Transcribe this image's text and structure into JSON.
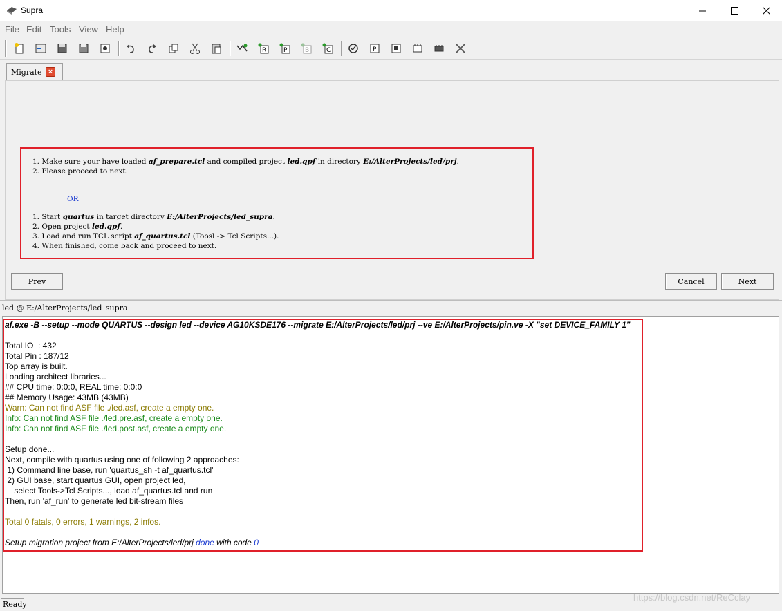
{
  "window": {
    "title": "Supra",
    "minimize_icon": "minimize-icon",
    "maximize_icon": "maximize-icon",
    "close_icon": "close-icon"
  },
  "menu": [
    "File",
    "Edit",
    "Tools",
    "View",
    "Help"
  ],
  "toolbar": {
    "icons": [
      "new-file-icon",
      "open-project-icon",
      "save-icon",
      "save-as-icon",
      "settings-icon",
      "undo-icon",
      "redo-icon",
      "copy-icon",
      "cut-icon",
      "paste-icon",
      "run-all-icon",
      "run-r-icon",
      "run-p-icon",
      "run-b-icon",
      "run-c-icon",
      "check-icon",
      "report-p-icon",
      "chip-icon",
      "program-icon",
      "device-icon",
      "stop-icon"
    ]
  },
  "tab": {
    "label": "Migrate",
    "close": "×"
  },
  "instructions": {
    "line1_num": "1.",
    "line1_a": "Make sure your have loaded ",
    "line1_b": "af_prepare.tcl",
    "line1_c": " and compiled project ",
    "line1_d": "led.qpf",
    "line1_e": " in directory ",
    "line1_f": "E:/AlterProjects/led/prj",
    "line1_g": ".",
    "line2": "2. Please proceed to next.",
    "or": "OR",
    "s1_a": "1. Start ",
    "s1_b": "quartus",
    "s1_c": " in target directory ",
    "s1_d": "E:/AlterProjects/led_supra",
    "s1_e": ".",
    "s2_a": "2. Open project ",
    "s2_b": "led.qpf",
    "s2_c": ".",
    "s3_a": "3. Load and run TCL script ",
    "s3_b": "af_quartus.tcl",
    "s3_c": " (Toosl -> Tcl Scripts...).",
    "s4": "4. When finished, come back and proceed to next."
  },
  "buttons": {
    "prev": "Prev",
    "cancel": "Cancel",
    "next": "Next"
  },
  "path_label": "led @ E:/AlterProjects/led_supra",
  "log": {
    "command": "af.exe -B --setup --mode QUARTUS --design led --device AG10KSDE176 --migrate E:/AlterProjects/led/prj --ve E:/AlterProjects/pin.ve -X \"set DEVICE_FAMILY 1\"",
    "lines": [
      "Total IO  : 432",
      "Total Pin : 187/12",
      "Top array is built.",
      "Loading architect libraries...",
      "## CPU time: 0:0:0, REAL time: 0:0:0",
      "## Memory Usage: 43MB (43MB)"
    ],
    "warn": "Warn: Can not find ASF file ./led.asf, create a empty one.",
    "info1": "Info: Can not find ASF file ./led.pre.asf, create a empty one.",
    "info2": "Info: Can not find ASF file ./led.post.asf, create a empty one.",
    "setup_lines": [
      "Setup done...",
      "Next, compile with quartus using one of following 2 approaches:",
      " 1) Command line base, run 'quartus_sh -t af_quartus.tcl'",
      " 2) GUI base, start quartus GUI, open project led,",
      "    select Tools->Tcl Scripts..., load af_quartus.tcl and run",
      "Then, run 'af_run' to generate led bit-stream files"
    ],
    "total": "Total 0 fatals, 0 errors, 1 warnings, 2 infos.",
    "final_a": "Setup migration project from E:/AlterProjects/led/prj ",
    "final_b": "done",
    "final_c": " with code ",
    "final_d": "0",
    "colors": {
      "warn": "#8a7a00",
      "info": "#1a8a1a",
      "total": "#8a7a00",
      "done": "#1a3ad0"
    }
  },
  "status": "Ready",
  "watermark": "https://blog.csdn.net/ReCclay"
}
